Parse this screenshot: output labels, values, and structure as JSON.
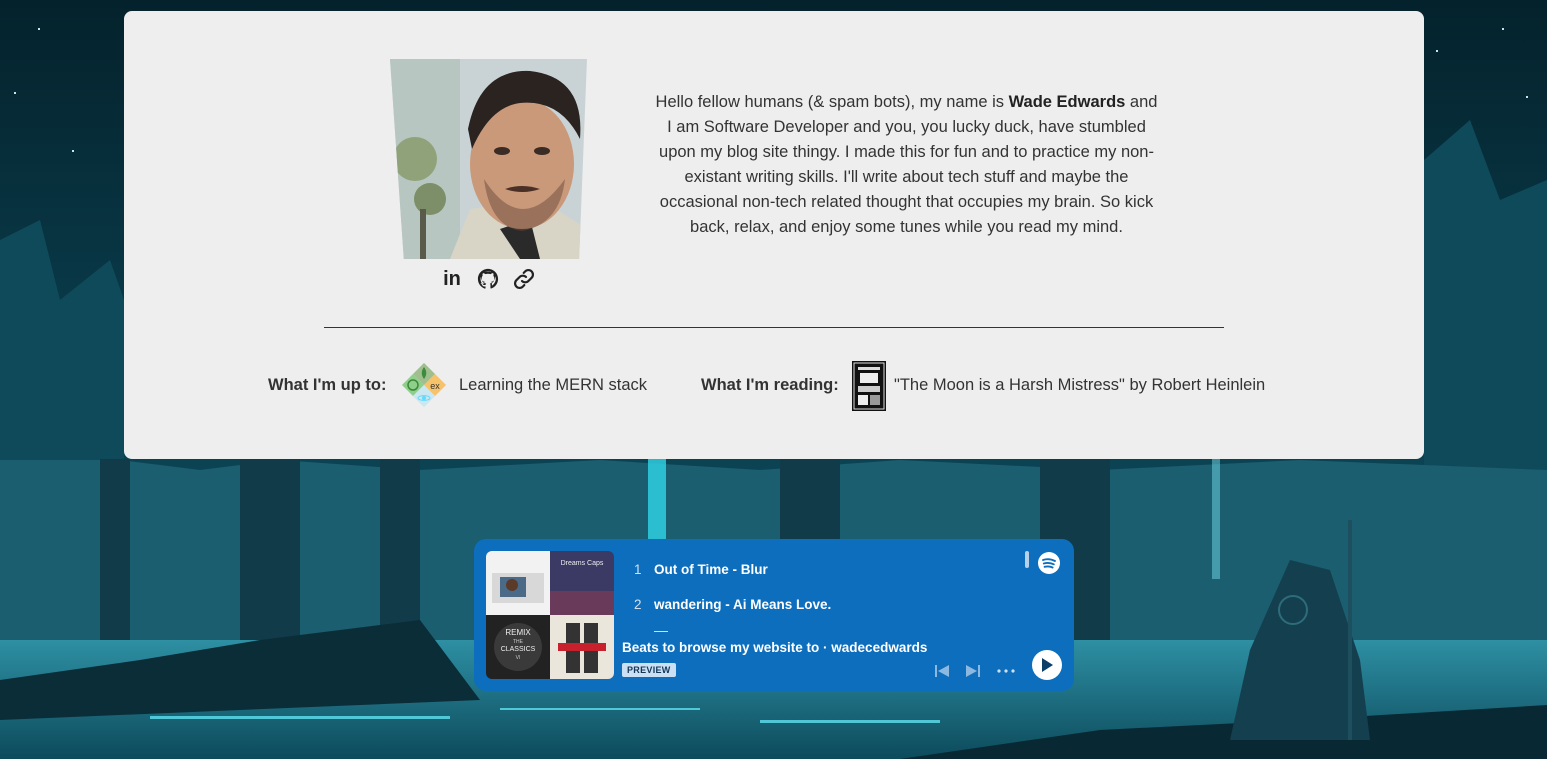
{
  "profile": {
    "bio_part1": "Hello fellow humans (& spam bots), my name is ",
    "name": "Wade Edwards",
    "bio_part2": " and I am Software Developer and you, you lucky duck, have stumbled upon my blog site thingy. I made this for fun and to practice my non-existant writing skills. I'll write about tech stuff and maybe the occasional non-tech related thought that occupies my brain. So kick back, relax, and enjoy some tunes while you read my mind.",
    "socials": [
      {
        "label": "in",
        "icon": "linkedin-icon"
      },
      {
        "icon": "github-icon"
      },
      {
        "icon": "link-icon"
      }
    ]
  },
  "status": {
    "up_to_label": "What I'm up to:",
    "up_to_icon_text": "ex",
    "up_to_text": "Learning the MERN stack",
    "reading_label": "What I'm reading:",
    "reading_text": "\"The Moon is a Harsh Mistress\" by Robert Heinlein"
  },
  "player": {
    "tracks": [
      {
        "num": "1",
        "title": "Out of Time - Blur"
      },
      {
        "num": "2",
        "title": "wandering - Ai Means Love."
      }
    ],
    "playlist_title": "Beats to browse my website to · wadecedwards",
    "badge": "PREVIEW",
    "art_labels": [
      "Dreams Caps",
      "REMIX",
      "THE",
      "CLASSICS",
      "VI"
    ],
    "colors": {
      "background": "#0c6ebd",
      "badge": "#cbe0f3"
    }
  }
}
